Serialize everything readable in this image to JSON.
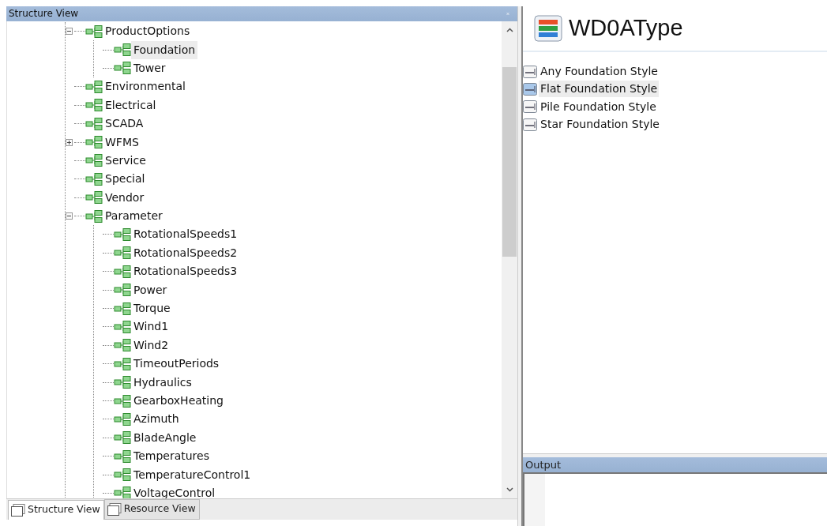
{
  "structure_panel": {
    "title": "Structure View",
    "tree": [
      {
        "label": "ProductOptions",
        "selected": false,
        "expanded": true,
        "children": [
          {
            "label": "Foundation",
            "selected": true
          },
          {
            "label": "Tower",
            "selected": false
          }
        ]
      },
      {
        "label": "Environmental",
        "selected": false
      },
      {
        "label": "Electrical",
        "selected": false
      },
      {
        "label": "SCADA",
        "selected": false
      },
      {
        "label": "WFMS",
        "selected": false,
        "expanded": false
      },
      {
        "label": "Service",
        "selected": false
      },
      {
        "label": "Special",
        "selected": false
      },
      {
        "label": "Vendor",
        "selected": false
      },
      {
        "label": "Parameter",
        "selected": false,
        "expanded": true,
        "children": [
          {
            "label": "RotationalSpeeds1",
            "selected": false
          },
          {
            "label": "RotationalSpeeds2",
            "selected": false
          },
          {
            "label": "RotationalSpeeds3",
            "selected": false
          },
          {
            "label": "Power",
            "selected": false
          },
          {
            "label": "Torque",
            "selected": false
          },
          {
            "label": "Wind1",
            "selected": false
          },
          {
            "label": "Wind2",
            "selected": false
          },
          {
            "label": "TimeoutPeriods",
            "selected": false
          },
          {
            "label": "Hydraulics",
            "selected": false
          },
          {
            "label": "GearboxHeating",
            "selected": false
          },
          {
            "label": "Azimuth",
            "selected": false
          },
          {
            "label": "BladeAngle",
            "selected": false
          },
          {
            "label": "Temperatures",
            "selected": false
          },
          {
            "label": "TemperatureControl1",
            "selected": false
          },
          {
            "label": "VoltageControl",
            "selected": false
          }
        ]
      }
    ],
    "tabs": [
      {
        "label": "Structure View",
        "selected": true
      },
      {
        "label": "Resource View",
        "selected": false
      }
    ]
  },
  "type_panel": {
    "title": "WD0AType",
    "items": [
      {
        "label": "Any Foundation Style",
        "selected": false
      },
      {
        "label": "Flat Foundation Style",
        "selected": true
      },
      {
        "label": "Pile Foundation Style",
        "selected": false
      },
      {
        "label": "Star Foundation Style",
        "selected": false
      }
    ]
  },
  "output_panel": {
    "title": "Output"
  }
}
